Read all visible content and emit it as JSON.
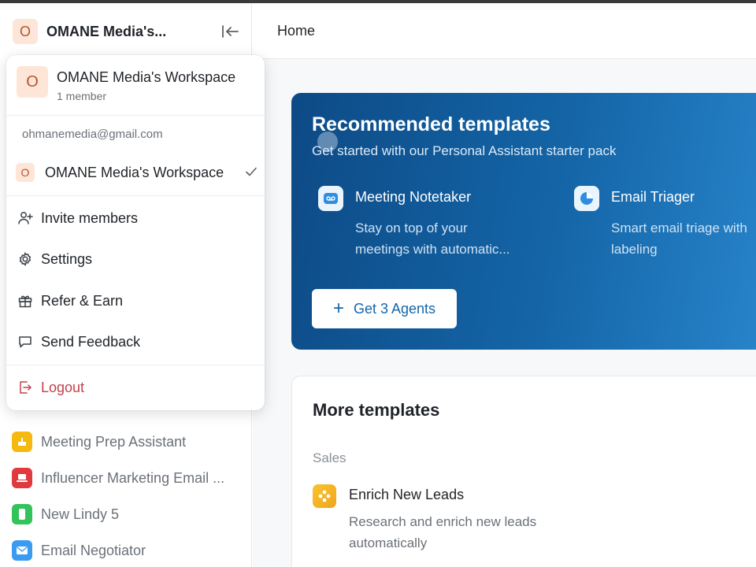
{
  "sidebar": {
    "workspace_initial": "O",
    "workspace_name_short": "OMANE Media's...",
    "agents": [
      {
        "label": "Meeting Prep Assistant",
        "color": "#f5b90f"
      },
      {
        "label": "Influencer Marketing Email ...",
        "color": "#e2393e"
      },
      {
        "label": "New Lindy 5",
        "color": "#34c35a"
      },
      {
        "label": "Email Negotiator",
        "color": "#3a9bf0"
      }
    ]
  },
  "workspace_menu": {
    "workspace_initial": "O",
    "workspace_name": "OMANE Media's Workspace",
    "member_count": "1 member",
    "email": "ohmanemedia@gmail.com",
    "workspace_option": "OMANE Media's Workspace",
    "items": {
      "invite": "Invite members",
      "settings": "Settings",
      "refer": "Refer & Earn",
      "feedback": "Send Feedback",
      "logout": "Logout"
    }
  },
  "main": {
    "breadcrumb": "Home",
    "recommended": {
      "title": "Recommended templates",
      "subtitle": "Get started with our Personal Assistant starter pack",
      "templates": [
        {
          "name": "Meeting Notetaker",
          "desc_line1": "Stay on top of your",
          "desc_line2": "meetings with automatic..."
        },
        {
          "name": "Email Triager",
          "desc_line1": "Smart email triage with",
          "desc_line2": "labeling"
        }
      ],
      "button_label": "Get 3 Agents"
    },
    "more": {
      "title": "More templates",
      "section": "Sales",
      "item_name": "Enrich New Leads",
      "item_desc": "Research and enrich new leads automatically"
    }
  },
  "colors": {
    "accent_blue": "#1466a8",
    "logout_red": "#c2414b",
    "workspace_avatar_bg": "#fde5d8"
  }
}
